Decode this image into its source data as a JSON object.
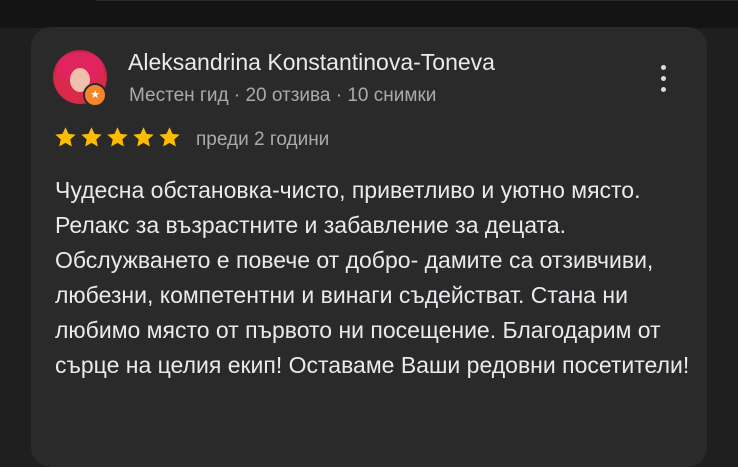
{
  "review": {
    "author": "Aleksandrina Konstantinova-Toneva",
    "author_meta": "Местен гид · 20 отзива · 10 снимки",
    "rating": 5,
    "rating_max": 5,
    "time_ago": "преди 2 години",
    "text": "Чудесна обстановка-чисто, приветливо и уютно място. Релакс за възрастните и забавление за децата. Обслужването е повече от добро- дамите са отзивчиви, любезни, компетентни и винаги съдействат. Стана ни любимо място от първото ни посещение. Благодарим от сърце на целия екип! Оставаме Ваши редовни посетители!"
  },
  "icons": {
    "avatar": "avatar",
    "local_guide_badge": "star-badge-icon",
    "more_options": "more-vert-icon",
    "rating_star": "star-icon"
  },
  "colors": {
    "background": "#1f1f1f",
    "card": "#2a2a2b",
    "primary_text": "#e8eaed",
    "secondary_text": "#a8abae",
    "star": "#fbbc04",
    "badge": "#f4852a"
  }
}
